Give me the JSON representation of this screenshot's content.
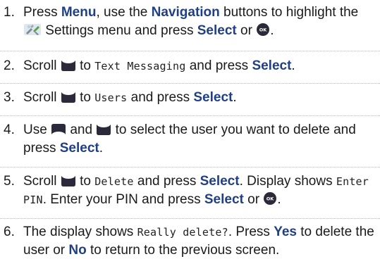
{
  "steps": [
    {
      "number": "1.",
      "parts": {
        "a": "Press ",
        "b": "Menu",
        "c": ", use the ",
        "d": "Navigation",
        "e": " buttons to highlight the ",
        "f": " Settings menu and press ",
        "g": "Select",
        "h": " or ",
        "i": "."
      }
    },
    {
      "number": "2.",
      "parts": {
        "a": "Scroll ",
        "b": " to ",
        "c": "Text Messaging",
        "d": " and press ",
        "e": "Select",
        "f": "."
      }
    },
    {
      "number": "3.",
      "parts": {
        "a": "Scroll ",
        "b": " to ",
        "c": "Users",
        "d": " and press ",
        "e": "Select",
        "f": "."
      }
    },
    {
      "number": "4.",
      "parts": {
        "a": "Use ",
        "b": " and ",
        "c": " to select the user you want to delete and press ",
        "d": "Select",
        "e": "."
      }
    },
    {
      "number": "5.",
      "parts": {
        "a": "Scroll ",
        "b": " to ",
        "c": "Delete",
        "d": " and press ",
        "e": "Select",
        "f": ". Display shows ",
        "g": "Enter PIN",
        "h": ". Enter your PIN and press ",
        "i": "Select",
        "j": " or ",
        "k": "."
      }
    },
    {
      "number": "6.",
      "parts": {
        "a": "The display shows ",
        "b": "Really delete?",
        "c": ". Press ",
        "d": "Yes",
        "e": " to delete the user or ",
        "f": "No",
        "g": " to return to the previous screen."
      }
    }
  ],
  "colors": {
    "keyword": "#1f3f87",
    "text": "#1a1a1a",
    "separator": "#b8b8b8",
    "key_icon": "#2a2a3a"
  },
  "icons": {
    "settings": "settings-icon",
    "ok_button": "ok-button-icon",
    "scroll_down": "scroll-down-key-icon",
    "scroll_up": "scroll-up-key-icon"
  }
}
